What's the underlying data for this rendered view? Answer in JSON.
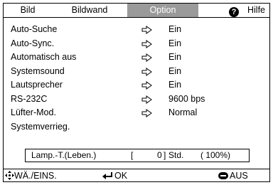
{
  "tabs": [
    {
      "label": "Bild"
    },
    {
      "label": "Bildwand"
    },
    {
      "label": "Option"
    },
    {
      "label": "Hilfe"
    }
  ],
  "active_tab": "Option",
  "menu": [
    {
      "label": "Auto-Suche",
      "value": "Ein"
    },
    {
      "label": "Auto-Sync.",
      "value": "Ein"
    },
    {
      "label": "Automatisch aus",
      "value": "Ein"
    },
    {
      "label": "Systemsound",
      "value": "Ein"
    },
    {
      "label": "Lautsprecher",
      "value": "Ein"
    },
    {
      "label": "RS-232C",
      "value": "9600 bps"
    },
    {
      "label": "Lüfter-Mod.",
      "value": "Normal"
    },
    {
      "label": "Systemverrieg.",
      "value": ""
    }
  ],
  "lamp": {
    "label": "Lamp.-T.(Leben.)",
    "bracket_open": "[",
    "hours": "0",
    "bracket_close": "]",
    "unit": "Std.",
    "percent": "( 100%)"
  },
  "footer": {
    "select_label": "WÄ./EINS.",
    "ok_label": "OK",
    "exit_label": "AUS"
  }
}
